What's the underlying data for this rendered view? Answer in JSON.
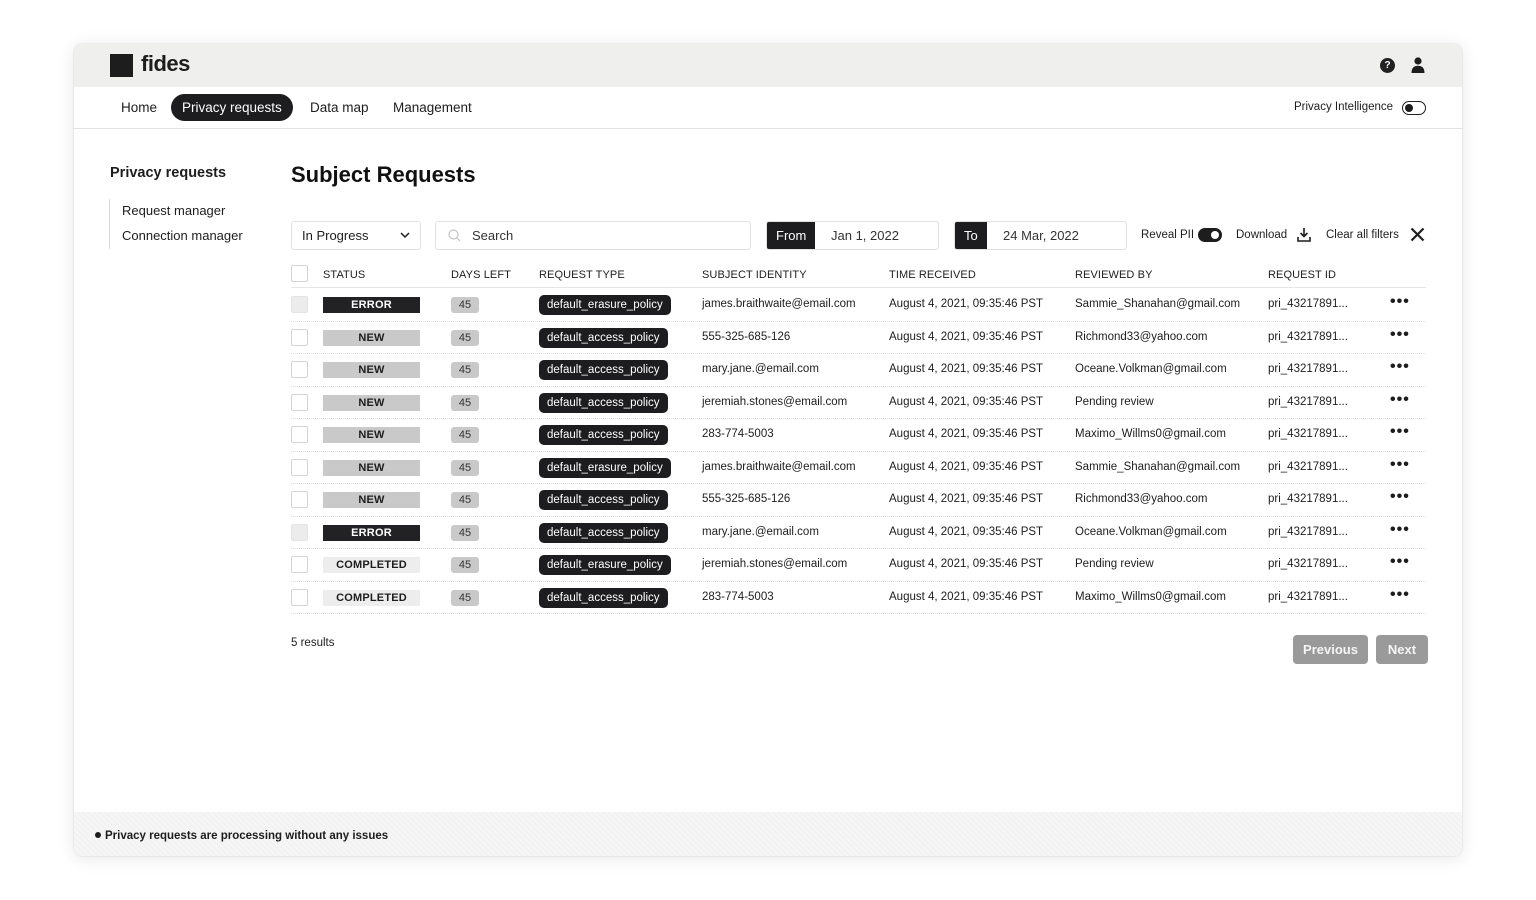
{
  "app": {
    "logo_text": "fides",
    "help_symbol": "?"
  },
  "nav": {
    "items": [
      {
        "label": "Home",
        "active": false
      },
      {
        "label": "Privacy requests",
        "active": true
      },
      {
        "label": "Data map",
        "active": false
      },
      {
        "label": "Management",
        "active": false
      }
    ],
    "privacy_intelligence_label": "Privacy Intelligence",
    "privacy_intelligence_on": false
  },
  "sidebar": {
    "title": "Privacy requests",
    "items": [
      {
        "label": "Request manager"
      },
      {
        "label": "Connection manager"
      }
    ]
  },
  "main": {
    "title": "Subject Requests",
    "filters": {
      "status_value": "In Progress",
      "search_placeholder": "Search",
      "from_label": "From",
      "from_value": "Jan 1, 2022",
      "to_label": "To",
      "to_value": "24 Mar, 2022",
      "reveal_pii_label": "Reveal PII",
      "reveal_pii_on": true,
      "download_label": "Download",
      "clear_label": "Clear all filters"
    },
    "table": {
      "headers": {
        "status": "STATUS",
        "days_left": "DAYS LEFT",
        "request_type": "REQUEST TYPE",
        "subject_identity": "SUBJECT IDENTITY",
        "time_received": "TIME RECEIVED",
        "reviewed_by": "REVIEWED BY",
        "request_id": "REQUEST ID"
      },
      "rows": [
        {
          "status": "ERROR",
          "status_kind": "error",
          "days_left": "45",
          "request_type": "default_erasure_policy",
          "subject_identity": "james.braithwaite@email.com",
          "time_received": "August 4, 2021, 09:35:46 PST",
          "reviewed_by": "Sammie_Shanahan@gmail.com",
          "request_id": "pri_43217891...",
          "more": "•••"
        },
        {
          "status": "NEW",
          "status_kind": "new",
          "days_left": "45",
          "request_type": "default_access_policy",
          "subject_identity": "555-325-685-126",
          "time_received": "August 4, 2021, 09:35:46 PST",
          "reviewed_by": "Richmond33@yahoo.com",
          "request_id": "pri_43217891...",
          "more": "•••"
        },
        {
          "status": "NEW",
          "status_kind": "new",
          "days_left": "45",
          "request_type": "default_access_policy",
          "subject_identity": "mary.jane.@email.com",
          "time_received": "August 4, 2021, 09:35:46 PST",
          "reviewed_by": "Oceane.Volkman@gmail.com",
          "request_id": "pri_43217891...",
          "more": "•••"
        },
        {
          "status": "NEW",
          "status_kind": "new",
          "days_left": "45",
          "request_type": "default_access_policy",
          "subject_identity": "jeremiah.stones@email.com",
          "time_received": "August 4, 2021, 09:35:46 PST",
          "reviewed_by": "Pending review",
          "request_id": "pri_43217891...",
          "more": "•••"
        },
        {
          "status": "NEW",
          "status_kind": "new",
          "days_left": "45",
          "request_type": "default_access_policy",
          "subject_identity": "283-774-5003",
          "time_received": "August 4, 2021, 09:35:46 PST",
          "reviewed_by": "Maximo_Willms0@gmail.com",
          "request_id": "pri_43217891...",
          "more": "•••"
        },
        {
          "status": "NEW",
          "status_kind": "new",
          "days_left": "45",
          "request_type": "default_erasure_policy",
          "subject_identity": "james.braithwaite@email.com",
          "time_received": "August 4, 2021, 09:35:46 PST",
          "reviewed_by": "Sammie_Shanahan@gmail.com",
          "request_id": "pri_43217891...",
          "more": "•••"
        },
        {
          "status": "NEW",
          "status_kind": "new",
          "days_left": "45",
          "request_type": "default_access_policy",
          "subject_identity": "555-325-685-126",
          "time_received": "August 4, 2021, 09:35:46 PST",
          "reviewed_by": "Richmond33@yahoo.com",
          "request_id": "pri_43217891...",
          "more": "•••"
        },
        {
          "status": "ERROR",
          "status_kind": "error",
          "days_left": "45",
          "request_type": "default_access_policy",
          "subject_identity": "mary.jane.@email.com",
          "time_received": "August 4, 2021, 09:35:46 PST",
          "reviewed_by": "Oceane.Volkman@gmail.com",
          "request_id": "pri_43217891...",
          "more": "•••"
        },
        {
          "status": "COMPLETED",
          "status_kind": "completed",
          "days_left": "45",
          "request_type": "default_erasure_policy",
          "subject_identity": "jeremiah.stones@email.com",
          "time_received": "August 4, 2021, 09:35:46 PST",
          "reviewed_by": "Pending review",
          "request_id": "pri_43217891...",
          "more": "•••"
        },
        {
          "status": "COMPLETED",
          "status_kind": "completed",
          "days_left": "45",
          "request_type": "default_access_policy",
          "subject_identity": "283-774-5003",
          "time_received": "August 4, 2021, 09:35:46 PST",
          "reviewed_by": "Maximo_Willms0@gmail.com",
          "request_id": "pri_43217891...",
          "more": "•••"
        }
      ]
    },
    "results_label": "5 results",
    "previous_label": "Previous",
    "next_label": "Next"
  },
  "footer": {
    "status_message": "Privacy requests are processing without any issues"
  },
  "colors": {
    "topbar_bg": "#efefed",
    "accent_dark": "#1d1d1f",
    "status_new": "#c9c9c9",
    "status_completed": "#ededed",
    "pagination_btn": "#9a9a9a"
  },
  "icons": [
    "logo-square",
    "help-icon",
    "user-icon",
    "chevron-down-icon",
    "search-icon",
    "download-icon",
    "close-icon",
    "more-icon"
  ]
}
